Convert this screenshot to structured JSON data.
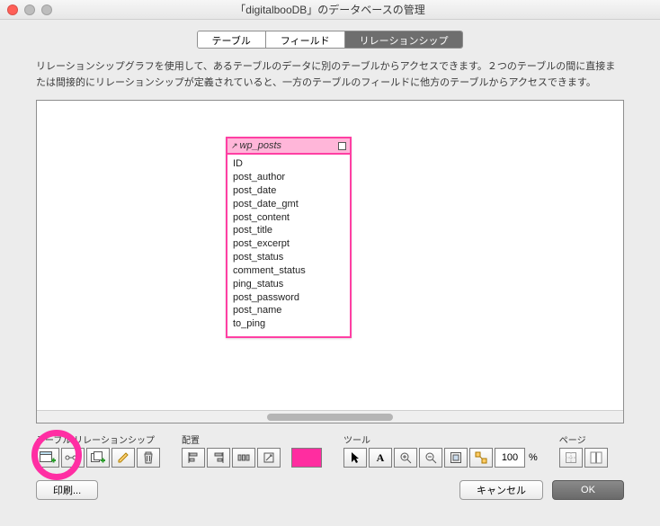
{
  "window": {
    "title": "「digitalbooDB」のデータベースの管理"
  },
  "tabs": {
    "table": "テーブル",
    "field": "フィールド",
    "relationship": "リレーションシップ"
  },
  "description": "リレーションシップグラフを使用して、あるテーブルのデータに別のテーブルからアクセスできます。２つのテーブルの間に直接または間接的にリレーションシップが定義されていると、一方のテーブルのフィールドに他方のテーブルからアクセスできます。",
  "occurrence": {
    "name": "wp_posts",
    "fields": [
      "ID",
      "post_author",
      "post_date",
      "post_date_gmt",
      "post_content",
      "post_title",
      "post_excerpt",
      "post_status",
      "comment_status",
      "ping_status",
      "post_password",
      "post_name",
      "to_ping"
    ]
  },
  "toolbar": {
    "group_tables_rel": "テーブル/リレーションシップ",
    "group_align": "配置",
    "group_tools": "ツール",
    "group_pages": "ページ",
    "zoom": "100",
    "zoom_suffix": "%"
  },
  "footer": {
    "print": "印刷...",
    "cancel": "キャンセル",
    "ok": "OK"
  }
}
